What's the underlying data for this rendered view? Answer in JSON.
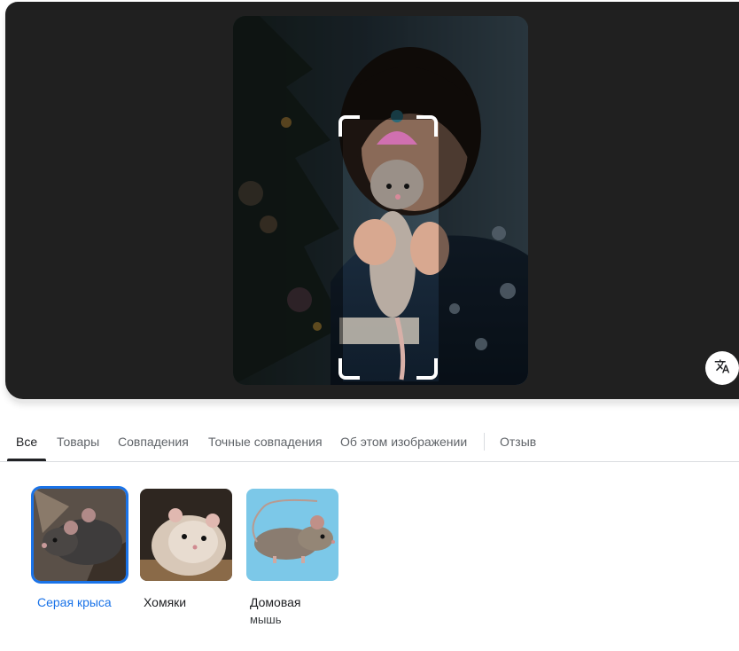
{
  "viewer": {
    "translate_icon": "translate-icon"
  },
  "tabs": [
    {
      "label": "Все",
      "active": true
    },
    {
      "label": "Товары"
    },
    {
      "label": "Совпадения"
    },
    {
      "label": "Точные совпадения"
    },
    {
      "label": "Об этом изображении"
    },
    {
      "label": "Отзыв"
    }
  ],
  "results": [
    {
      "label": "Серая крыса",
      "selected": true
    },
    {
      "label": "Хомяки"
    },
    {
      "label": "Домовая",
      "label_line2": "мышь"
    }
  ],
  "colors": {
    "accent": "#1a73e8",
    "viewer_bg": "#202020"
  }
}
